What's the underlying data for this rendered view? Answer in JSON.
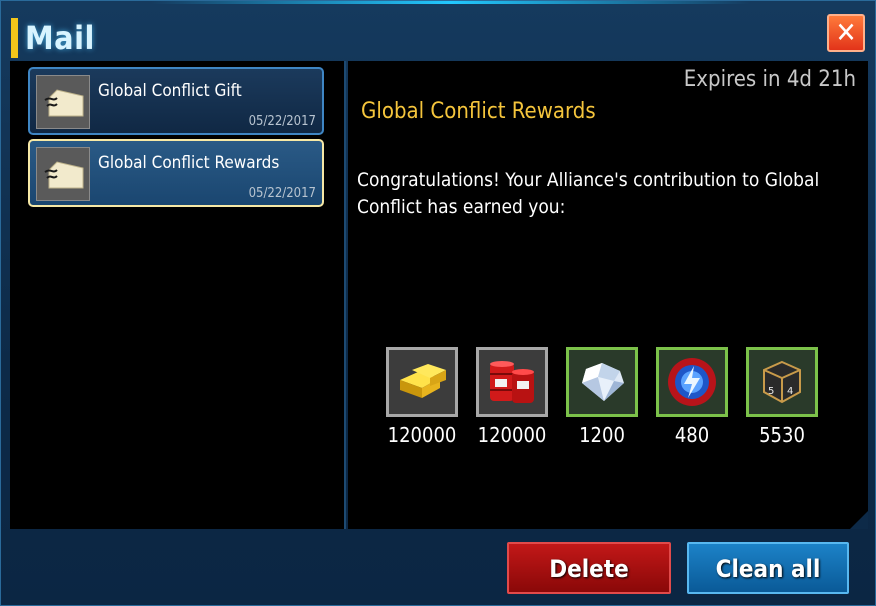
{
  "window": {
    "title": "Mail",
    "close_label": "✕"
  },
  "mail_list": [
    {
      "title": "Global Conflict Gift",
      "date": "05/22/2017",
      "selected": false
    },
    {
      "title": "Global Conflict Rewards",
      "date": "05/22/2017",
      "selected": true
    }
  ],
  "detail": {
    "expires": "Expires in 4d 21h",
    "title": "Global Conflict Rewards",
    "body": "Congratulations! Your Alliance's contribution to Global Conflict has earned you:",
    "items": [
      {
        "icon": "gold-bars-icon",
        "quantity": "120000"
      },
      {
        "icon": "oil-barrels-icon",
        "quantity": "120000"
      },
      {
        "icon": "diamond-icon",
        "quantity": "1200"
      },
      {
        "icon": "energy-orb-icon",
        "quantity": "480"
      },
      {
        "icon": "dice-box-icon",
        "quantity": "5530"
      }
    ]
  },
  "buttons": {
    "delete_label": "Delete",
    "clean_all_label": "Clean all"
  },
  "colors": {
    "accent_yellow": "#f2c61a",
    "reward_title": "#f5c53c",
    "delete_red": "#c21818",
    "clean_blue": "#1c82c8"
  }
}
